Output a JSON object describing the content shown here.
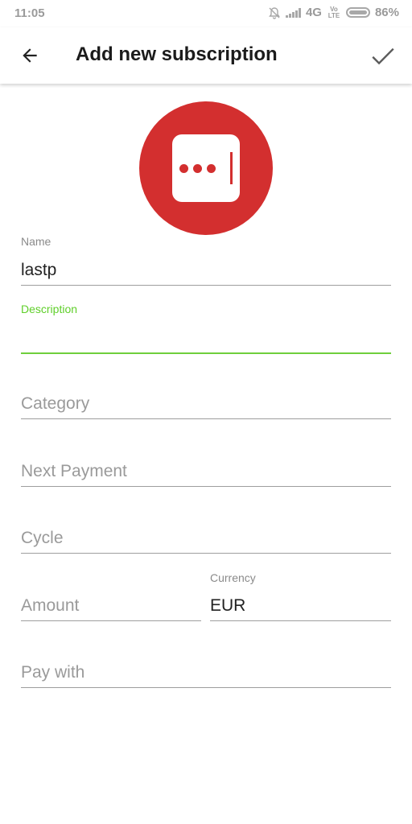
{
  "status_bar": {
    "time": "11:05",
    "network": "4G",
    "volte": "Vo LTE",
    "battery": "86%"
  },
  "app_bar": {
    "title": "Add new subscription"
  },
  "form": {
    "name": {
      "label": "Name",
      "value": "lastp"
    },
    "description": {
      "label": "Description",
      "value": ""
    },
    "category": {
      "placeholder": "Category"
    },
    "next_payment": {
      "placeholder": "Next Payment"
    },
    "cycle": {
      "placeholder": "Cycle"
    },
    "amount": {
      "placeholder": "Amount"
    },
    "currency": {
      "label": "Currency",
      "value": "EUR"
    },
    "pay_with": {
      "placeholder": "Pay with"
    }
  },
  "colors": {
    "accent_green": "#6fcf3c",
    "logo_red": "#d32f2f"
  }
}
